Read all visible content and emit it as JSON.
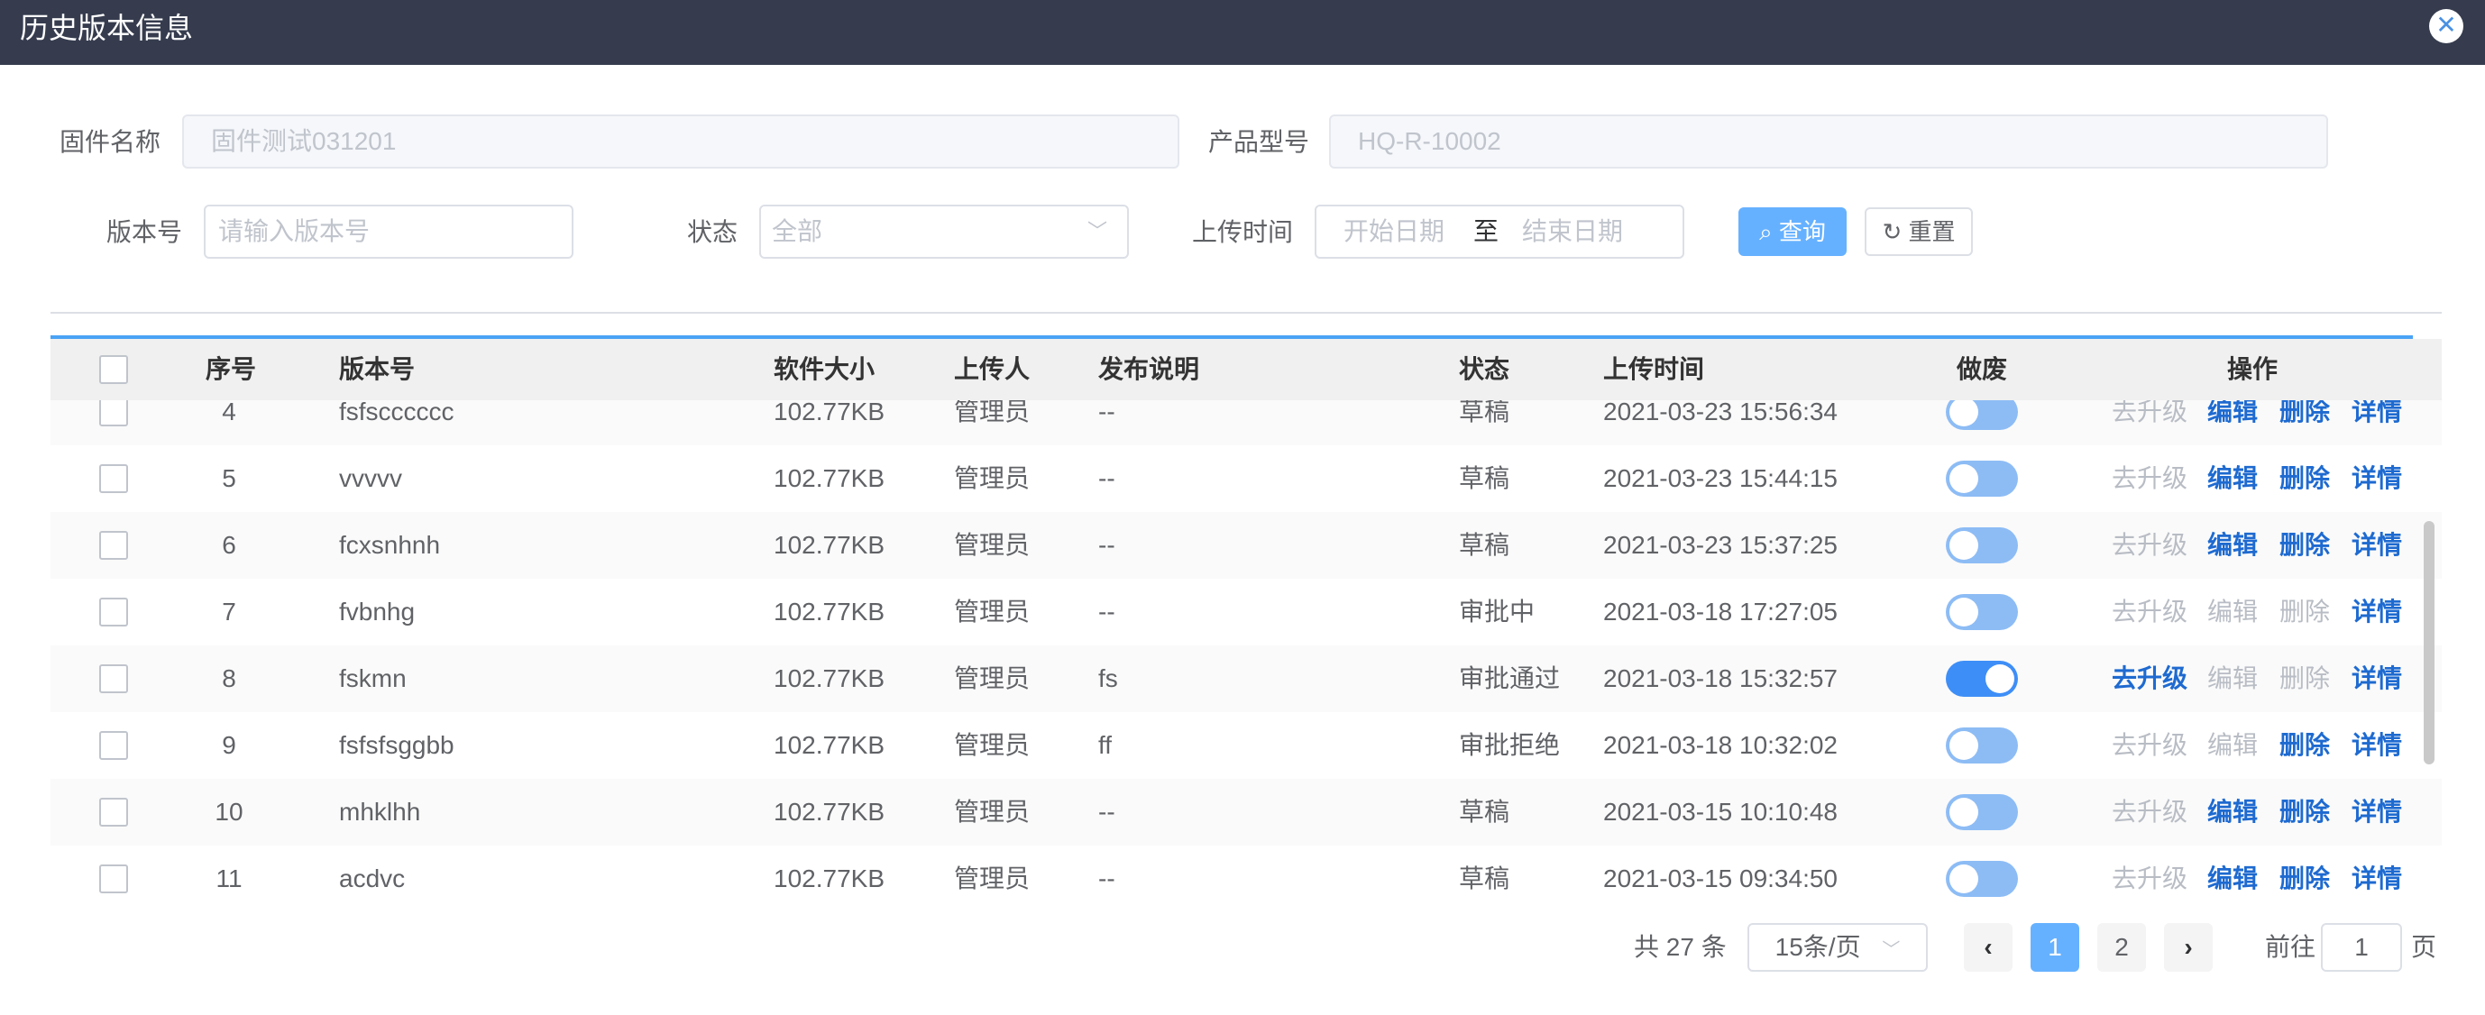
{
  "dialog": {
    "title": "历史版本信息",
    "close_icon": "close-icon"
  },
  "filters": {
    "firmware_name_label": "固件名称",
    "firmware_name_value": "固件测试031201",
    "product_model_label": "产品型号",
    "product_model_value": "HQ-R-10002",
    "version_label": "版本号",
    "version_placeholder": "请输入版本号",
    "status_label": "状态",
    "status_value": "全部",
    "upload_time_label": "上传时间",
    "start_date_placeholder": "开始日期",
    "range_separator": "至",
    "end_date_placeholder": "结束日期",
    "search_button": "查询",
    "reset_button": "重置"
  },
  "table": {
    "headers": [
      "序号",
      "版本号",
      "软件大小",
      "上传人",
      "发布说明",
      "状态",
      "上传时间",
      "做废",
      "操作"
    ],
    "action_labels": [
      "去升级",
      "编辑",
      "删除",
      "详情"
    ],
    "rows": [
      {
        "index": "4",
        "version": "fsfscccccc",
        "size": "102.77KB",
        "uploader": "管理员",
        "notes": "--",
        "status": "草稿",
        "time": "2021-03-23 15:56:34",
        "toggle_on": false,
        "actions": [
          false,
          true,
          true,
          true
        ]
      },
      {
        "index": "5",
        "version": "vvvvv",
        "size": "102.77KB",
        "uploader": "管理员",
        "notes": "--",
        "status": "草稿",
        "time": "2021-03-23 15:44:15",
        "toggle_on": false,
        "actions": [
          false,
          true,
          true,
          true
        ]
      },
      {
        "index": "6",
        "version": "fcxsnhnh",
        "size": "102.77KB",
        "uploader": "管理员",
        "notes": "--",
        "status": "草稿",
        "time": "2021-03-23 15:37:25",
        "toggle_on": false,
        "actions": [
          false,
          true,
          true,
          true
        ]
      },
      {
        "index": "7",
        "version": "fvbnhg",
        "size": "102.77KB",
        "uploader": "管理员",
        "notes": "--",
        "status": "审批中",
        "time": "2021-03-18 17:27:05",
        "toggle_on": false,
        "actions": [
          false,
          false,
          false,
          true
        ]
      },
      {
        "index": "8",
        "version": "fskmn",
        "size": "102.77KB",
        "uploader": "管理员",
        "notes": "fs",
        "status": "审批通过",
        "time": "2021-03-18 15:32:57",
        "toggle_on": true,
        "actions": [
          true,
          false,
          false,
          true
        ]
      },
      {
        "index": "9",
        "version": "fsfsfsggbb",
        "size": "102.77KB",
        "uploader": "管理员",
        "notes": "ff",
        "status": "审批拒绝",
        "time": "2021-03-18 10:32:02",
        "toggle_on": false,
        "actions": [
          false,
          false,
          true,
          true
        ]
      },
      {
        "index": "10",
        "version": "mhklhh",
        "size": "102.77KB",
        "uploader": "管理员",
        "notes": "--",
        "status": "草稿",
        "time": "2021-03-15 10:10:48",
        "toggle_on": false,
        "actions": [
          false,
          true,
          true,
          true
        ]
      },
      {
        "index": "11",
        "version": "acdvc",
        "size": "102.77KB",
        "uploader": "管理员",
        "notes": "--",
        "status": "草稿",
        "time": "2021-03-15 09:34:50",
        "toggle_on": false,
        "actions": [
          false,
          true,
          true,
          true
        ]
      }
    ]
  },
  "pagination": {
    "total_text": "共 27 条",
    "page_size": "15条/页",
    "pages": [
      "1",
      "2"
    ],
    "current_page": "1",
    "goto_label": "前往",
    "goto_value": "1",
    "goto_suffix": "页"
  },
  "colors": {
    "header_bg": "#363c4e",
    "primary": "#66b1ff",
    "link": "#1e6ad0",
    "switch_on": "#3e8ef7",
    "switch_off": "#8dbcf5"
  }
}
